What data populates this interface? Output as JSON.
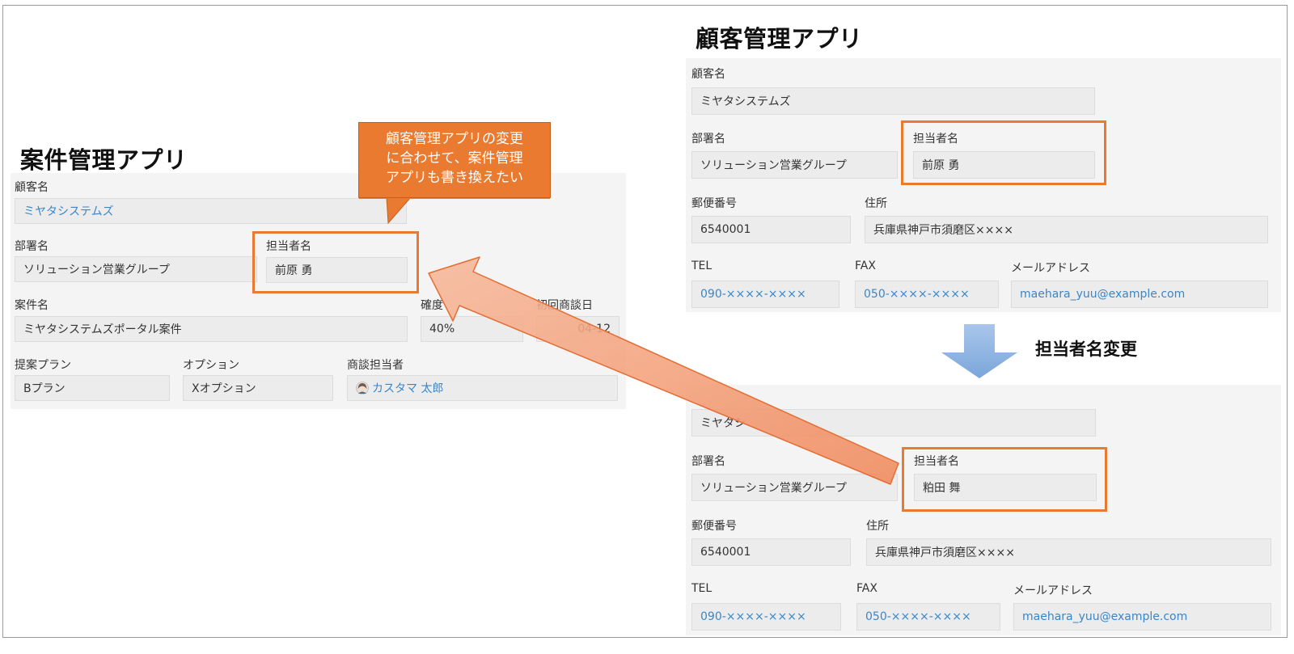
{
  "left_app": {
    "title": "案件管理アプリ",
    "customer_name": {
      "label": "顧客名",
      "value": "ミヤタシステムズ"
    },
    "department": {
      "label": "部署名",
      "value": "ソリューション営業グループ"
    },
    "person": {
      "label": "担当者名",
      "value": "前原 勇"
    },
    "deal_name": {
      "label": "案件名",
      "value": "ミヤタシステムズポータル案件"
    },
    "certainty": {
      "label": "確度",
      "value": "40%"
    },
    "first_meeting": {
      "label": "初回商談日",
      "value": "04-12"
    },
    "plan": {
      "label": "提案プラン",
      "value": "Bプラン"
    },
    "option": {
      "label": "オプション",
      "value": "Xオプション"
    },
    "sales_rep": {
      "label": "商談担当者",
      "value": "カスタマ 太郎"
    }
  },
  "callout": {
    "lines": [
      "顧客管理アプリの変更",
      "に合わせて、案件管理",
      "アプリも書き換えたい"
    ]
  },
  "right_app": {
    "title": "顧客管理アプリ",
    "before": {
      "customer_name": {
        "label": "顧客名",
        "value": "ミヤタシステムズ"
      },
      "department": {
        "label": "部署名",
        "value": "ソリューション営業グループ"
      },
      "person": {
        "label": "担当者名",
        "value": "前原 勇"
      },
      "postal": {
        "label": "郵便番号",
        "value": "6540001"
      },
      "address": {
        "label": "住所",
        "value": "兵庫県神戸市須磨区××××"
      },
      "tel": {
        "label": "TEL",
        "value": "090-××××-××××"
      },
      "fax": {
        "label": "FAX",
        "value": "050-××××-××××"
      },
      "email": {
        "label": "メールアドレス",
        "value": "maehara_yuu@example.com"
      }
    },
    "change_label": "担当者名変更",
    "after": {
      "customer_name": {
        "value": "ミヤタシ"
      },
      "department": {
        "label": "部署名",
        "value": "ソリューション営業グループ"
      },
      "person": {
        "label": "担当者名",
        "value": "粕田 舞"
      },
      "postal": {
        "label": "郵便番号",
        "value": "6540001"
      },
      "address": {
        "label": "住所",
        "value": "兵庫県神戸市須磨区××××"
      },
      "tel": {
        "label": "TEL",
        "value": "090-××××-××××"
      },
      "fax": {
        "label": "FAX",
        "value": "050-××××-××××"
      },
      "email": {
        "label": "メールアドレス",
        "value": "maehara_yuu@example.com"
      }
    }
  },
  "colors": {
    "highlight": "#ea7a2f",
    "link": "#3a86c8",
    "down_arrow": "#8fb4e0",
    "sync_arrow": "#f3a07a"
  },
  "icons": {
    "down_arrow": "down-arrow-icon",
    "sync_arrow": "diagonal-arrow-icon",
    "avatar": "user-avatar-icon"
  }
}
